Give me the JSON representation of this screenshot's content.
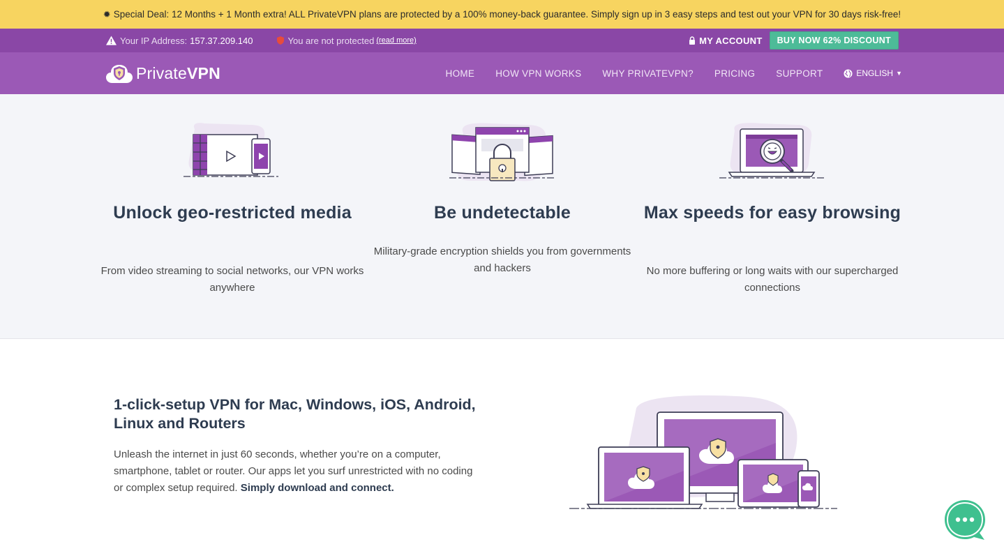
{
  "promo": {
    "text": "Special Deal: 12 Months + 1 Month extra! ALL PrivateVPN plans are protected by a 100% money-back guarantee. Simply sign up in 3 easy steps and test out your VPN for 30 days risk-free!"
  },
  "infobar": {
    "ip_label": "Your IP Address:",
    "ip_value": "157.37.209.140",
    "protection_status": "You are not protected",
    "read_more": "(read more)",
    "my_account": "MY ACCOUNT",
    "buy_now": "BUY NOW 62% DISCOUNT"
  },
  "nav": {
    "logo_prefix": "Private",
    "logo_suffix": "VPN",
    "items": [
      "HOME",
      "HOW VPN WORKS",
      "WHY PRIVATEVPN?",
      "PRICING",
      "SUPPORT"
    ],
    "language": "ENGLISH"
  },
  "features": [
    {
      "icon": "video-devices-icon",
      "title": "Unlock geo-restricted media",
      "text": "From video streaming to social networks, our VPN works anywhere"
    },
    {
      "icon": "padlock-browser-icon",
      "title": "Be undetectable",
      "text": "Military-grade encryption shields you from governments and hackers"
    },
    {
      "icon": "speed-magnifier-icon",
      "title": "Max speeds for easy browsing",
      "text": "No more buffering or long waits with our supercharged connections"
    }
  ],
  "setup": {
    "title": "1-click-setup VPN for Mac, Windows, iOS, Android, Linux and Routers",
    "body": "Unleash the internet in just 60 seconds, whether you’re on a computer, smartphone, tablet or router. Our apps let you surf unrestricted with no coding or complex setup required.",
    "body_bold": "Simply download and connect."
  },
  "colors": {
    "promo_bg": "#f7d460",
    "infobar_bg": "#8a47a6",
    "nav_bg": "#9b59b6",
    "buy_button": "#4dbb98",
    "heading": "#2e3c50",
    "features_bg": "#f4f5f9",
    "chat_button": "#3fc08f"
  }
}
